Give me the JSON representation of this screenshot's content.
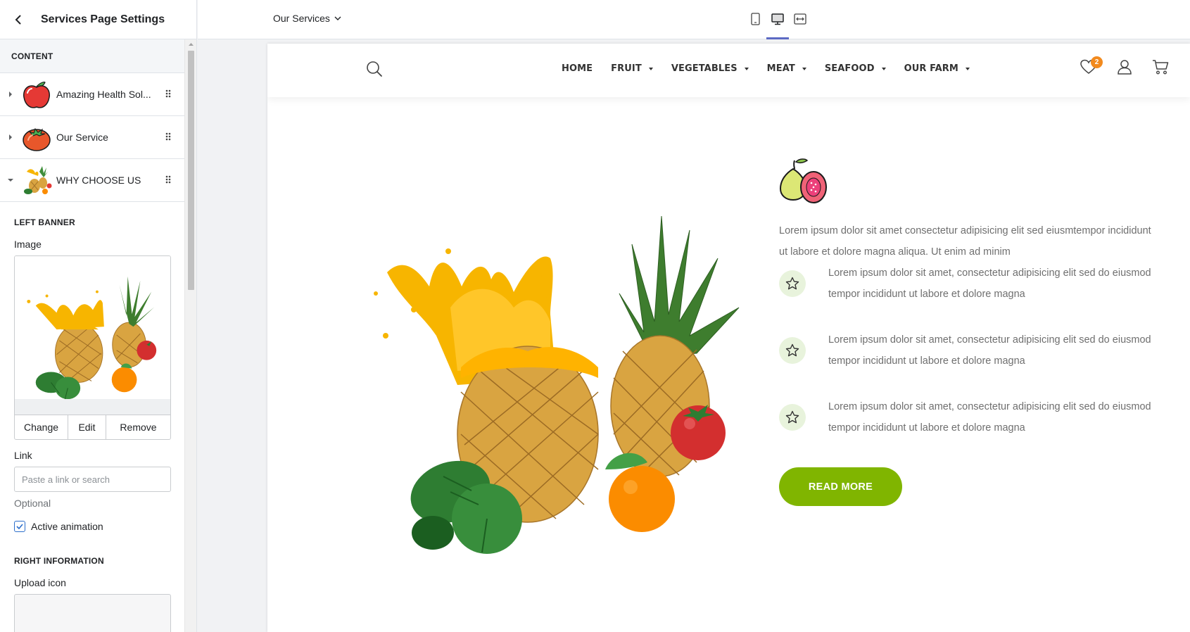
{
  "panel": {
    "title": "Services Page Settings",
    "section_label": "CONTENT",
    "blocks": [
      {
        "label": "Amazing Health Sol...",
        "icon": "apple-icon"
      },
      {
        "label": "Our Service",
        "icon": "tomato-icon"
      },
      {
        "label": "WHY CHOOSE US",
        "icon": "juice-fruits-icon"
      }
    ],
    "left_banner": {
      "heading": "LEFT BANNER",
      "image_label": "Image",
      "change": "Change",
      "edit": "Edit",
      "remove": "Remove",
      "link_label": "Link",
      "link_placeholder": "Paste a link or search",
      "link_help": "Optional",
      "animation_label": "Active animation",
      "animation_checked": true
    },
    "right_info": {
      "heading": "RIGHT INFORMATION",
      "upload_label": "Upload icon"
    }
  },
  "topbar": {
    "page_select": "Our Services",
    "devices": [
      "mobile-icon",
      "desktop-icon",
      "fullwidth-icon"
    ],
    "active_device": "desktop-icon",
    "accent": "#5c6ac4"
  },
  "store": {
    "nav": [
      {
        "label": "HOME",
        "dropdown": false
      },
      {
        "label": "FRUIT",
        "dropdown": true
      },
      {
        "label": "VEGETABLES",
        "dropdown": true
      },
      {
        "label": "MEAT",
        "dropdown": true
      },
      {
        "label": "SEAFOOD",
        "dropdown": true
      },
      {
        "label": "OUR FARM",
        "dropdown": true
      }
    ],
    "wishlist_count": "2",
    "intro": "Lorem ipsum dolor sit amet consectetur adipisicing elit sed eiusmtempor incididunt ut labore et dolore magna aliqua. Ut enim ad minim",
    "features": [
      "Lorem ipsum dolor sit amet, consectetur adipisicing elit sed do eiusmod tempor incididunt ut labore et dolore magna",
      "Lorem ipsum dolor sit amet, consectetur adipisicing elit sed do eiusmod tempor incididunt ut labore et dolore magna",
      "Lorem ipsum dolor sit amet, consectetur adipisicing elit sed do eiusmod tempor incididunt ut labore et dolore magna"
    ],
    "button": "READ MORE",
    "brand_color": "#80b500",
    "badge_color": "#f28a1e"
  }
}
